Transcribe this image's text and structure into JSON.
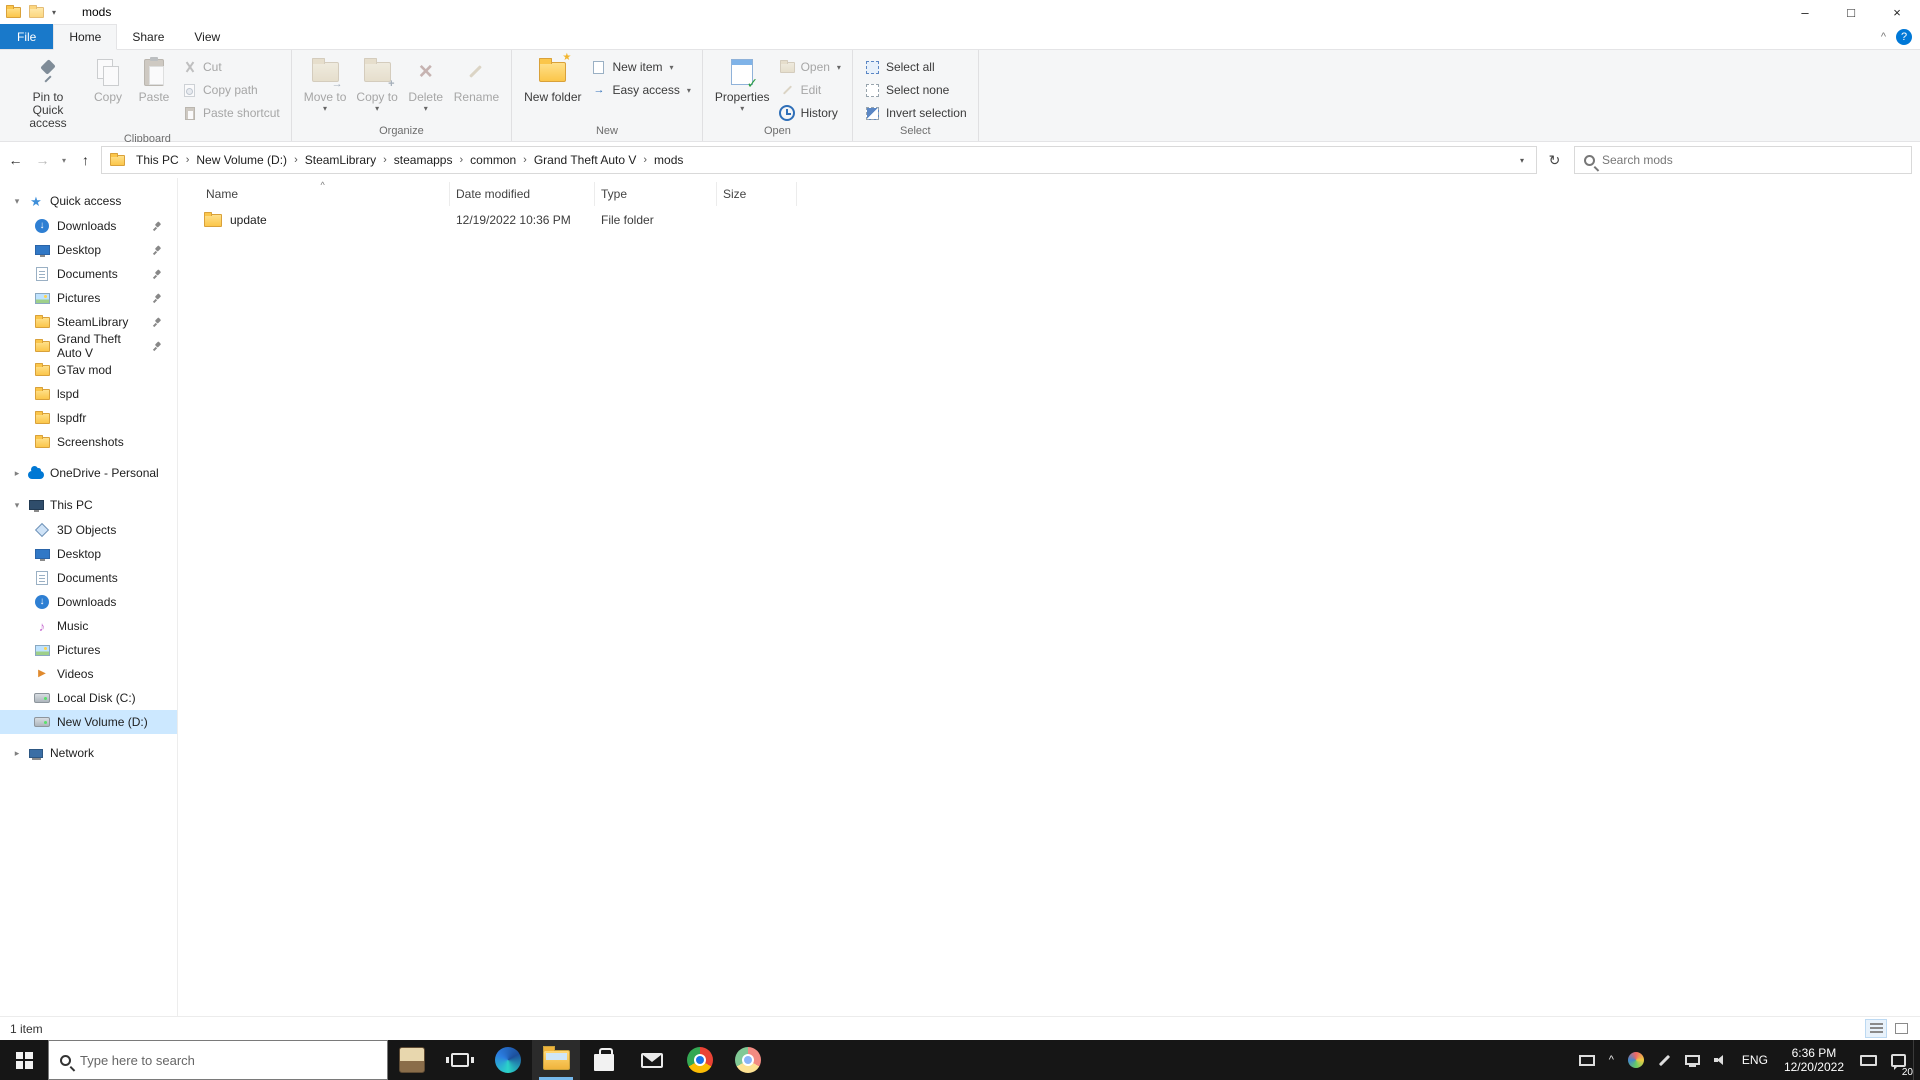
{
  "colors": {
    "accent": "#0078d7",
    "file_tab": "#1979ca",
    "selection": "#cce8ff",
    "taskbar_bg": "#161616",
    "taskbar_active_underline": "#76b9ed"
  },
  "icons": {
    "minimize": "–",
    "maximize": "□",
    "close": "×",
    "help": "?",
    "ribbon_collapse": "^",
    "back": "←",
    "forward": "→",
    "up": "↑",
    "refresh": "↻",
    "dropdown": "▾",
    "chevron_down": "▾",
    "chevron_right": "▸",
    "breadcrumb_sep": "›",
    "sort_asc": "^",
    "star": "★",
    "check": "✓",
    "delete_x": "×",
    "plus": "+",
    "arrow_down": "↓",
    "music_note": "♪",
    "play": "▶",
    "move_arrow": "→",
    "easy_access_arrow": "→"
  },
  "window": {
    "title": "mods"
  },
  "ribbon": {
    "file_tab": "File",
    "tabs": [
      {
        "label": "Home"
      },
      {
        "label": "Share"
      },
      {
        "label": "View"
      }
    ],
    "groups": {
      "clipboard": {
        "label": "Clipboard",
        "pin": "Pin to Quick access",
        "copy": "Copy",
        "paste": "Paste",
        "cut": "Cut",
        "copy_path": "Copy path",
        "paste_shortcut": "Paste shortcut"
      },
      "organize": {
        "label": "Organize",
        "move_to": "Move to",
        "copy_to": "Copy to",
        "delete": "Delete",
        "rename": "Rename"
      },
      "new": {
        "label": "New",
        "new_folder": "New folder",
        "new_item": "New item",
        "easy_access": "Easy access"
      },
      "open": {
        "label": "Open",
        "properties": "Properties",
        "open": "Open",
        "edit": "Edit",
        "history": "History"
      },
      "select": {
        "label": "Select",
        "select_all": "Select all",
        "select_none": "Select none",
        "invert": "Invert selection"
      }
    }
  },
  "address_bar": {
    "breadcrumbs": [
      "This PC",
      "New Volume (D:)",
      "SteamLibrary",
      "steamapps",
      "common",
      "Grand Theft Auto V",
      "mods"
    ],
    "search_placeholder": "Search mods"
  },
  "sidebar": {
    "quick_access": {
      "label": "Quick access",
      "items": [
        {
          "label": "Downloads",
          "pinned": true
        },
        {
          "label": "Desktop",
          "pinned": true
        },
        {
          "label": "Documents",
          "pinned": true
        },
        {
          "label": "Pictures",
          "pinned": true
        },
        {
          "label": "SteamLibrary",
          "pinned": true
        },
        {
          "label": "Grand Theft Auto V",
          "pinned": true
        },
        {
          "label": "GTav mod",
          "pinned": false
        },
        {
          "label": "lspd",
          "pinned": false
        },
        {
          "label": "lspdfr",
          "pinned": false
        },
        {
          "label": "Screenshots",
          "pinned": false
        }
      ]
    },
    "onedrive": {
      "label": "OneDrive - Personal"
    },
    "this_pc": {
      "label": "This PC",
      "items": [
        {
          "label": "3D Objects"
        },
        {
          "label": "Desktop"
        },
        {
          "label": "Documents"
        },
        {
          "label": "Downloads"
        },
        {
          "label": "Music"
        },
        {
          "label": "Pictures"
        },
        {
          "label": "Videos"
        },
        {
          "label": "Local Disk (C:)"
        },
        {
          "label": "New Volume (D:)",
          "selected": true
        }
      ]
    },
    "network": {
      "label": "Network"
    }
  },
  "file_list": {
    "columns": [
      "Name",
      "Date modified",
      "Type",
      "Size"
    ],
    "rows": [
      {
        "name": "update",
        "date_modified": "12/19/2022 10:36 PM",
        "type": "File folder",
        "size": ""
      }
    ]
  },
  "status_bar": {
    "items_count": "1 item"
  },
  "taskbar": {
    "search_placeholder": "Type here to search",
    "tray": {
      "language": "ENG",
      "time": "6:36 PM",
      "date": "12/20/2022",
      "badge": "20"
    }
  }
}
